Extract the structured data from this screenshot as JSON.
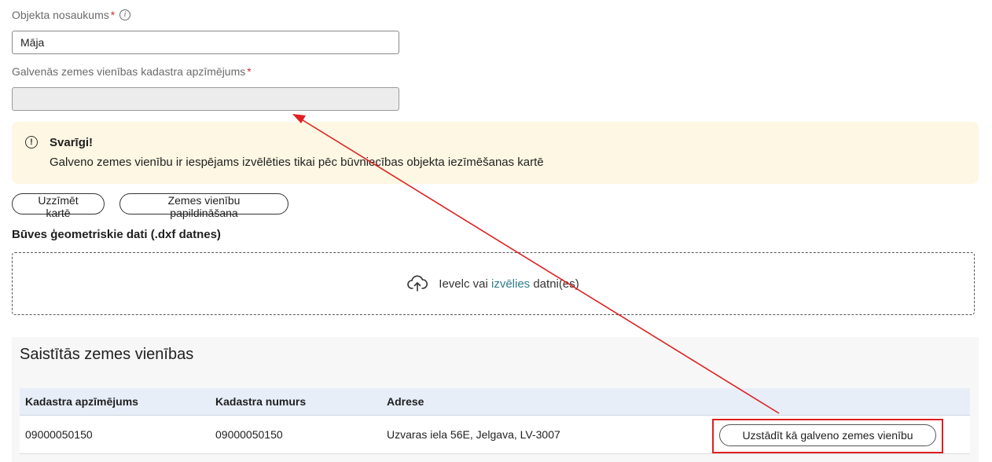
{
  "form": {
    "object_name": {
      "label": "Objekta nosaukums",
      "required_mark": "*",
      "value": "Māja"
    },
    "cadastral_designation": {
      "label": "Galvenās zemes vienības kadastra apzīmējums",
      "required_mark": "*",
      "value": ""
    }
  },
  "alert": {
    "title": "Svarīgi!",
    "text": "Galveno zemes vienību ir iespējams izvēlēties tikai pēc būvniecības objekta iezīmēšanas kartē"
  },
  "actions": {
    "draw_on_map": "Uzzīmēt kartē",
    "land_units_add": "Zemes vienību papildināšana"
  },
  "geometry": {
    "heading": "Būves ģeometriskie dati (.dxf datnes)",
    "drop_text_before": "Ievelc vai ",
    "drop_link": "izvēlies",
    "drop_text_after": " datni(es)"
  },
  "linked": {
    "title": "Saistītās zemes vienības",
    "columns": [
      "Kadastra apzīmējums",
      "Kadastra numurs",
      "Adrese"
    ],
    "rows": [
      {
        "designation": "09000050150",
        "number": "09000050150",
        "address": "Uzvaras iela 56E, Jelgava, LV-3007",
        "action": "Uzstādīt kā galveno zemes vienību"
      }
    ]
  },
  "colors": {
    "alert_bg": "#fdf7e3",
    "table_header_bg": "#e8eef8",
    "link": "#2e7d8c",
    "annotation": "#e02020"
  },
  "icons": {
    "info": "info-icon",
    "warning": "exclamation-circle-icon",
    "upload": "cloud-upload-icon"
  }
}
